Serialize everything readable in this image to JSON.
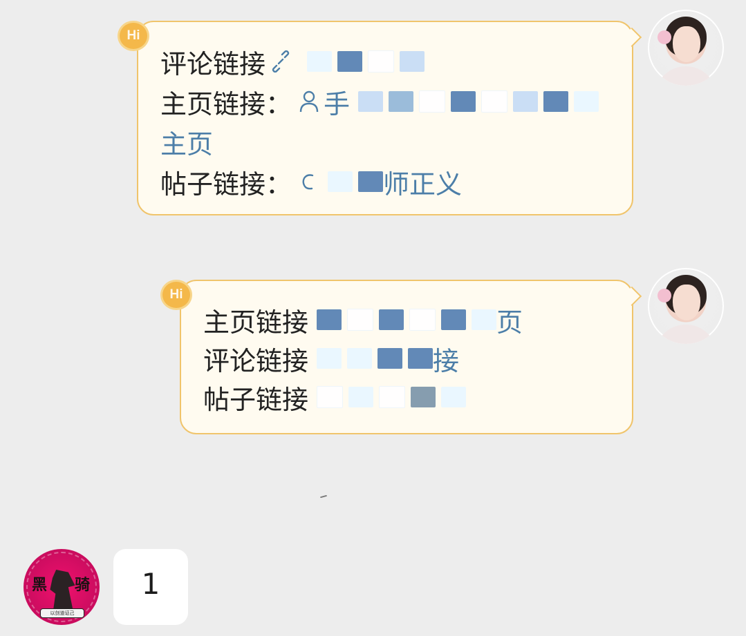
{
  "messages": [
    {
      "id": "msg-1",
      "lines": [
        {
          "type": "text",
          "text": "评论链接"
        },
        {
          "type": "text",
          "text": "主页链接："
        },
        {
          "type": "link",
          "text": "主页"
        },
        {
          "type": "text",
          "text": "帖子链接："
        }
      ]
    },
    {
      "id": "msg-2",
      "lines": [
        {
          "type": "text",
          "text": "主页链接"
        },
        {
          "type": "text",
          "text": "评论链接"
        },
        {
          "type": "text",
          "text": "帖子链接"
        }
      ]
    }
  ],
  "partial_text": {
    "msg1_line2": "手",
    "msg1_line4": "师正义",
    "msg2_line1": "页",
    "msg2_line2": "接"
  },
  "badges": {
    "hi": "Hi"
  },
  "user_message": {
    "text": "1"
  },
  "avatars": {
    "sender": "woman-avatar",
    "receiver": "knight-avatar"
  },
  "knight_avatar": {
    "left_char": "黑",
    "right_char": "骑",
    "banner_text": "以剑道证己"
  },
  "colors": {
    "background": "#ededed",
    "bubble_fill": "#fffbf0",
    "bubble_border": "#f0c46b",
    "link": "#4c7ea8",
    "badge": "#f4b84a"
  }
}
